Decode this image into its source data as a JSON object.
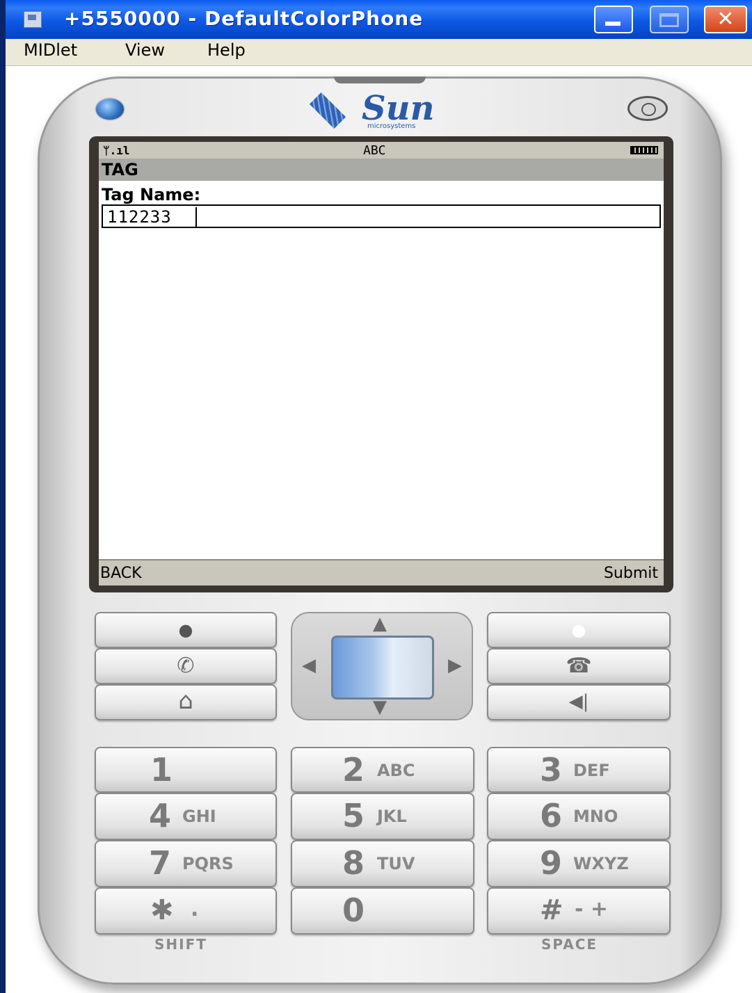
{
  "window": {
    "title": "+5550000 - DefaultColorPhone",
    "controls": {
      "close_glyph": "✕"
    }
  },
  "menu": [
    "MIDlet",
    "View",
    "Help"
  ],
  "phone": {
    "brand": "Sun",
    "brand_sub": "microsystems",
    "status_bar": {
      "signal": "ᛘ.ıl",
      "input_mode": "ABC"
    },
    "screen_title": "TAG",
    "field_label": "Tag Name:",
    "field_value": "112233",
    "softkeys": {
      "left": "BACK",
      "right": "Submit"
    }
  },
  "nav_glyphs": {
    "up": "▲",
    "down": "▼",
    "left": "◀",
    "right": "▶"
  },
  "function_keys": {
    "left_soft": "●",
    "call": "✆",
    "home": "⌂",
    "right_soft": "●",
    "end": "☎",
    "clear": "◀|"
  },
  "keypad": [
    {
      "digit": "1",
      "letters": ""
    },
    {
      "digit": "2",
      "letters": "ABC"
    },
    {
      "digit": "3",
      "letters": "DEF"
    },
    {
      "digit": "4",
      "letters": "GHI"
    },
    {
      "digit": "5",
      "letters": "JKL"
    },
    {
      "digit": "6",
      "letters": "MNO"
    },
    {
      "digit": "7",
      "letters": "PQRS"
    },
    {
      "digit": "8",
      "letters": "TUV"
    },
    {
      "digit": "9",
      "letters": "WXYZ"
    },
    {
      "digit": "✱",
      "letters": "."
    },
    {
      "digit": "0",
      "letters": ""
    },
    {
      "digit": "#",
      "letters": "- +"
    }
  ],
  "key_captions": {
    "star": "SHIFT",
    "pound": "SPACE"
  },
  "colors": {
    "titlebar": "#0a5bf0",
    "brand": "#2a5aa8",
    "screen_bar": "#c9c6bc"
  }
}
